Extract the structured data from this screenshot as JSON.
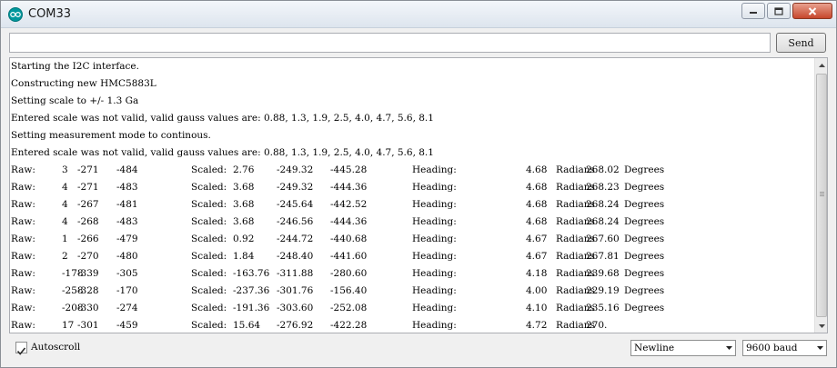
{
  "window": {
    "title": "COM33"
  },
  "send_bar": {
    "input_value": "",
    "send_label": "Send"
  },
  "output": {
    "lines": [
      [
        "Starting the I2C interface."
      ],
      [
        "Constructing new HMC5883L"
      ],
      [
        "Setting scale to +/- 1.3 Ga"
      ],
      [
        "Entered scale was not valid, valid gauss values are: 0.88, 1.3, 1.9, 2.5, 4.0, 4.7, 5.6, 8.1"
      ],
      [
        "Setting measurement mode to continous."
      ],
      [
        "Entered scale was not valid, valid gauss values are: 0.88, 1.3, 1.9, 2.5, 4.0, 4.7, 5.6, 8.1"
      ],
      [
        "Raw:",
        "3",
        "-271",
        "-484",
        "Scaled:",
        "2.76",
        "-249.32",
        "-445.28",
        "Heading:",
        "4.68",
        "Radians",
        "268.02",
        "Degrees"
      ],
      [
        "Raw:",
        "4",
        "-271",
        "-483",
        "Scaled:",
        "3.68",
        "-249.32",
        "-444.36",
        "Heading:",
        "4.68",
        "Radians",
        "268.23",
        "Degrees"
      ],
      [
        "Raw:",
        "4",
        "-267",
        "-481",
        "Scaled:",
        "3.68",
        "-245.64",
        "-442.52",
        "Heading:",
        "4.68",
        "Radians",
        "268.24",
        "Degrees"
      ],
      [
        "Raw:",
        "4",
        "-268",
        "-483",
        "Scaled:",
        "3.68",
        "-246.56",
        "-444.36",
        "Heading:",
        "4.68",
        "Radians",
        "268.24",
        "Degrees"
      ],
      [
        "Raw:",
        "1",
        "-266",
        "-479",
        "Scaled:",
        "0.92",
        "-244.72",
        "-440.68",
        "Heading:",
        "4.67",
        "Radians",
        "267.60",
        "Degrees"
      ],
      [
        "Raw:",
        "2",
        "-270",
        "-480",
        "Scaled:",
        "1.84",
        "-248.40",
        "-441.60",
        "Heading:",
        "4.67",
        "Radians",
        "267.81",
        "Degrees"
      ],
      [
        "Raw:",
        "-178",
        "-339",
        "-305",
        "Scaled:",
        "-163.76",
        "-311.88",
        "-280.60",
        "Heading:",
        "4.18",
        "Radians",
        "239.68",
        "Degrees"
      ],
      [
        "Raw:",
        "-258",
        "-328",
        "-170",
        "Scaled:",
        "-237.36",
        "-301.76",
        "-156.40",
        "Heading:",
        "4.00",
        "Radians",
        "229.19",
        "Degrees"
      ],
      [
        "Raw:",
        "-208",
        "-330",
        "-274",
        "Scaled:",
        "-191.36",
        "-303.60",
        "-252.08",
        "Heading:",
        "4.10",
        "Radians",
        "235.16",
        "Degrees"
      ],
      [
        "Raw:",
        "17",
        "-301",
        "-459",
        "Scaled:",
        "15.64",
        "-276.92",
        "-422.28",
        "Heading:",
        "4.72",
        "Radians",
        "270."
      ]
    ]
  },
  "bottom_bar": {
    "autoscroll_label": "Autoscroll",
    "autoscroll_checked": true,
    "line_ending": "Newline",
    "baud_rate": "9600 baud"
  },
  "colors": {
    "arduino_teal": "#00979c",
    "close_red": "#c7472c"
  }
}
